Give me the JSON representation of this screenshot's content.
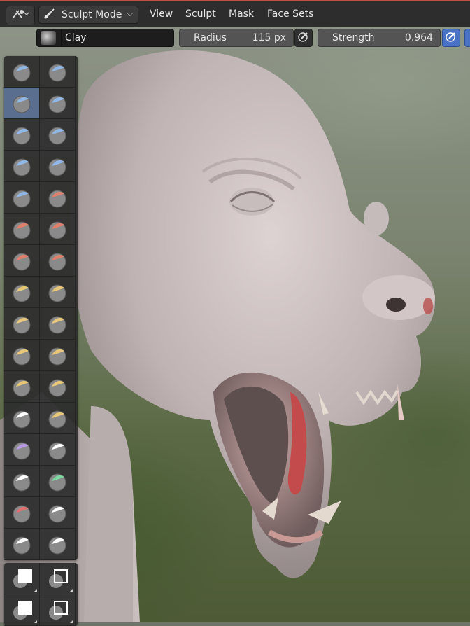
{
  "header": {
    "editor_type_icon": "sculpt-editor-icon",
    "mode": {
      "label": "Sculpt Mode",
      "icon": "brush-icon"
    },
    "menus": [
      "View",
      "Sculpt",
      "Mask",
      "Face Sets"
    ],
    "accent": "#c24b4b"
  },
  "tool_settings": {
    "brush_name": "Clay",
    "radius": {
      "label": "Radius",
      "value": "115 px"
    },
    "strength": {
      "label": "Strength",
      "value": "0.964"
    },
    "pressure_active_color": "#4a72c4"
  },
  "toolbox": {
    "brushes": [
      "draw",
      "draw-sharp",
      "clay",
      "clay-strips",
      "clay-thumb",
      "layer",
      "inflate",
      "blob",
      "crease",
      "smooth",
      "flatten",
      "fill",
      "scrape",
      "multiplane-scrape",
      "pinch",
      "grab",
      "elastic-deform",
      "snake-hook",
      "thumb",
      "pose",
      "nudge",
      "rotate",
      "slide-relax",
      "boundary",
      "cloth",
      "simplify",
      "mask",
      "draw-face-sets",
      "multires-displacement-eraser",
      "multires-displacement-smear",
      "paint",
      "smear"
    ],
    "active": "clay",
    "utility_tools": [
      "box-mask",
      "box-hide",
      "box-face-set",
      "box-trim"
    ]
  }
}
